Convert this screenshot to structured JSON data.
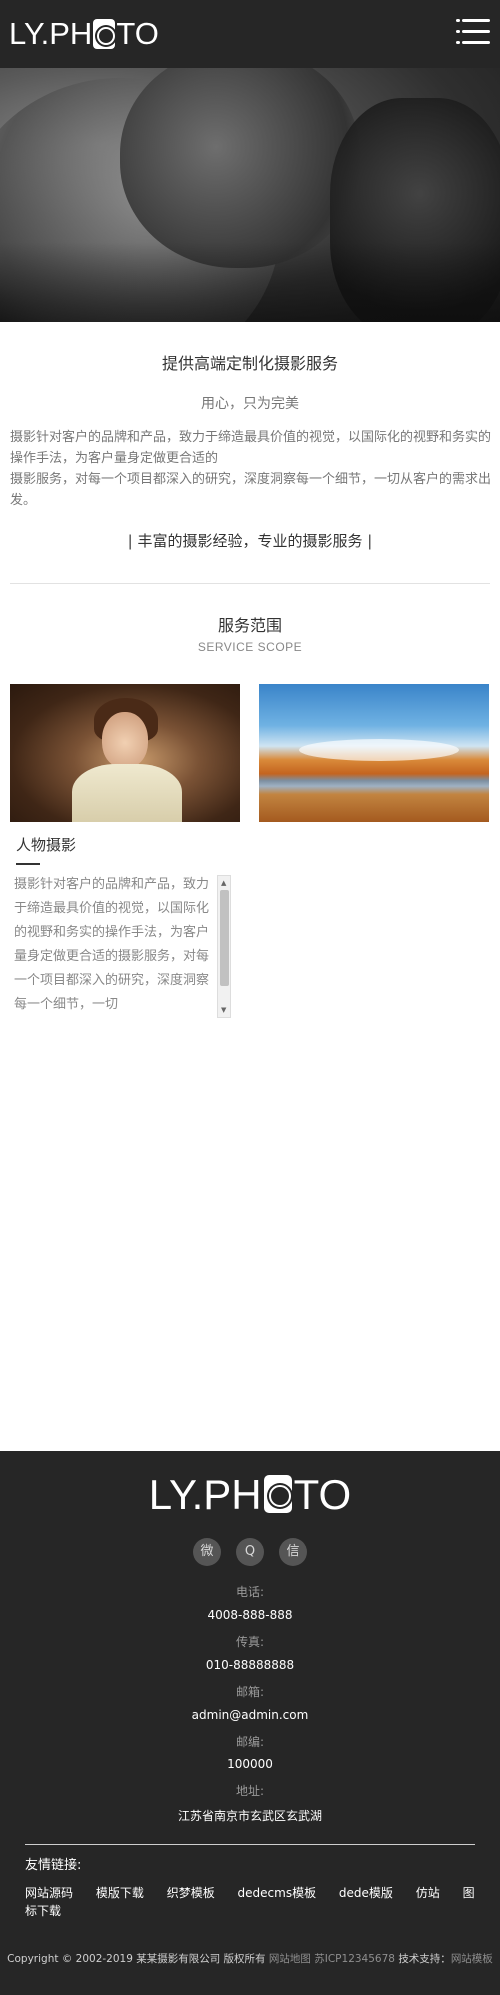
{
  "header": {
    "logo_text_left": "LY.PH",
    "logo_text_right": "TO",
    "menu_icon": "hamburger-menu-icon"
  },
  "intro": {
    "title": "提供高端定制化摄影服务",
    "subtitle": "用心，只为完美",
    "para1": "摄影针对客户的品牌和产品，致力于缔造最具价值的视觉，以国际化的视野和务实的操作手法，为客户量身定做更合适的",
    "para2": "摄影服务，对每一个项目都深入的研究，深度洞察每一个细节，一切从客户的需求出发。",
    "tagline": "| 丰富的摄影经验，专业的摄影服务 |"
  },
  "scope": {
    "title": "服务范围",
    "subtitle": "SERVICE SCOPE"
  },
  "cards": [
    {
      "title": "人物摄影",
      "text": "摄影针对客户的品牌和产品，致力于缔造最具价值的视觉，以国际化的视野和务实的操作手法，为客户量身定做更合适的摄影服务，对每一个项目都深入的研究，深度洞察每一个细节，一切"
    }
  ],
  "footer": {
    "logo_left": "LY.PH",
    "logo_right": "TO",
    "socials": [
      {
        "icon": "weibo-icon",
        "glyph": "微"
      },
      {
        "icon": "qq-icon",
        "glyph": "Q"
      },
      {
        "icon": "wechat-icon",
        "glyph": "信"
      }
    ],
    "phone_label": "电话:",
    "phone": "4008-888-888",
    "fax_label": "传真:",
    "fax": "010-88888888",
    "email_label": "邮箱:",
    "email": "admin@admin.com",
    "zip_label": "邮编:",
    "zip": "100000",
    "address_label": "地址:",
    "address": "江苏省南京市玄武区玄武湖",
    "links_title": "友情链接:",
    "links": [
      "网站源码",
      "模版下载",
      "织梦模板",
      "dedecms模板",
      "dede模版",
      "仿站",
      "图标下载"
    ],
    "copyright": "Copyright © 2002-2019 某某摄影有限公司 版权所有",
    "sitemap": "网站地图",
    "icp": "苏ICP12345678",
    "support_label": "技术支持：",
    "support_link": "网站模板"
  }
}
